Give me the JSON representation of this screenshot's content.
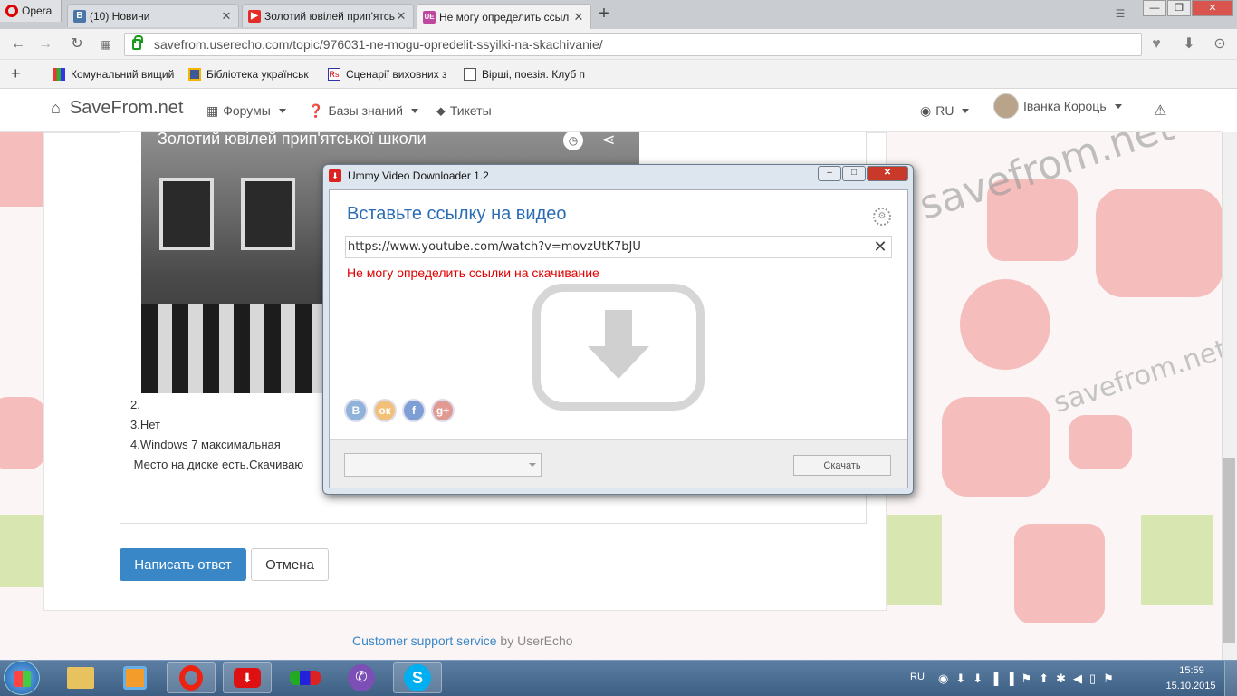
{
  "browser": {
    "menu_label": "Opera",
    "tabs": [
      {
        "title": "(10) Новини",
        "favicon_text": "B",
        "favicon_color": "#4a76a8"
      },
      {
        "title": "Золотий ювілей прип'ятсь",
        "favicon_text": "▶",
        "favicon_color": "#e52d27"
      },
      {
        "title": "Не могу определить ссыл",
        "favicon_text": "UE",
        "favicon_color": "#c0479f"
      }
    ],
    "new_tab": "+",
    "url": "savefrom.userecho.com/topic/976031-ne-mogu-opredelit-ssyilki-na-skachivanie/",
    "bookmarks": [
      {
        "label": "Комунальний вищий"
      },
      {
        "label": "Бібліотека українськ"
      },
      {
        "label": "Сценарії виховних з"
      },
      {
        "label": "Вірші, поезія. Клуб п"
      }
    ],
    "add_bookmark": "+"
  },
  "site": {
    "logo": "SaveFrom.net",
    "nav": {
      "forums": "Форумы",
      "knowledge": "Базы знаний",
      "tickets": "Тикеты",
      "lang": "RU",
      "user": "Іванка Короць"
    },
    "video_title": "Золотий ювілей прип'ятської школи",
    "post_lines": [
      "2.",
      "3.Нет",
      "4.Windows 7 максимальная",
      " Место на диске есть.Скачиваю"
    ],
    "reply_button": "Написать ответ",
    "cancel_button": "Отмена",
    "footer_link": "Customer support service",
    "footer_by": " by UserEcho",
    "watermark": "savefrom.net"
  },
  "dialog": {
    "title": "Ummy Video Downloader 1.2",
    "heading": "Вставьте ссылку на видео",
    "url_value": "https://www.youtube.com/watch?v=movzUtK7bJU",
    "error": "Не могу определить ссылки на скачивание",
    "social": [
      "B",
      "ок",
      "f",
      "g+"
    ],
    "download_button": "Скачать",
    "format_value": ""
  },
  "taskbar": {
    "lang": "RU",
    "time": "15:59",
    "date": "15.10.2015"
  },
  "colors": {
    "accent": "#3a87c8",
    "error": "#e00000",
    "dialog_heading": "#2a6db5"
  }
}
